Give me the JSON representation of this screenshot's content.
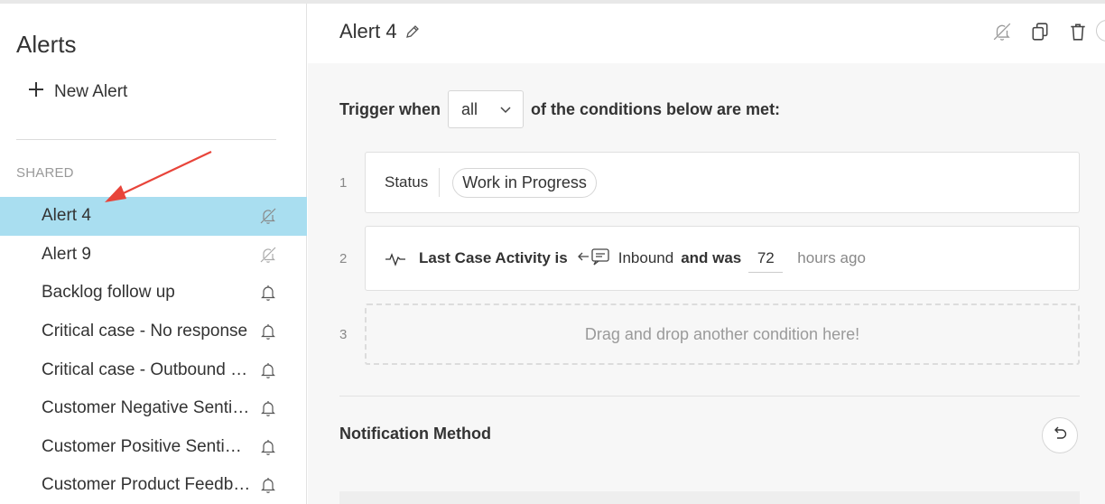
{
  "sidebar": {
    "title": "Alerts",
    "new_alert_label": "New Alert",
    "section_label": "SHARED",
    "items": [
      {
        "label": "Alert 4",
        "icon": "bell-off-icon"
      },
      {
        "label": "Alert 9",
        "icon": "bell-off-icon"
      },
      {
        "label": "Backlog follow up",
        "icon": "bell-icon"
      },
      {
        "label": "Critical case - No response",
        "icon": "bell-icon"
      },
      {
        "label": "Critical case - Outbound response",
        "icon": "bell-icon"
      },
      {
        "label": "Customer Negative Sentiment",
        "icon": "bell-icon"
      },
      {
        "label": "Customer Positive Sentiment",
        "icon": "bell-icon"
      },
      {
        "label": "Customer Product Feedback",
        "icon": "bell-icon"
      }
    ],
    "selected_index": 0
  },
  "header": {
    "title": "Alert 4",
    "icons": [
      "bell-off-icon",
      "copy-icon",
      "trash-icon"
    ]
  },
  "trigger": {
    "prefix": "Trigger when",
    "select_value": "all",
    "suffix": "of the conditions below are met:"
  },
  "conditions": [
    {
      "number": "1",
      "field": "Status",
      "value": "Work in Progress"
    },
    {
      "number": "2",
      "field_prefix": "Last Case Activity is",
      "channel": "Inbound",
      "connector": "and was",
      "hours": "72",
      "suffix": "hours ago"
    },
    {
      "number": "3",
      "placeholder": "Drag and drop another condition here!"
    }
  ],
  "notification": {
    "title": "Notification Method"
  },
  "colors": {
    "selected_bg": "#a9def0",
    "annotation_arrow": "#e8443a"
  }
}
